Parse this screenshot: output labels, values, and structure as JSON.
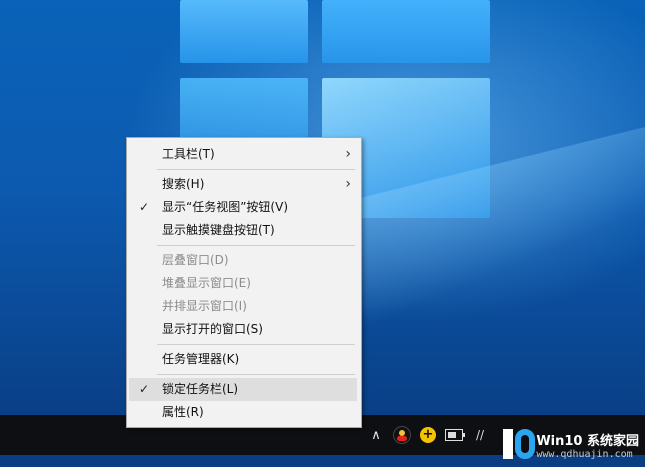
{
  "context_menu": {
    "items": [
      {
        "label": "工具栏(T)",
        "submenu": true,
        "checked": false,
        "disabled": false
      },
      {
        "label": "搜索(H)",
        "submenu": true,
        "checked": false,
        "disabled": false
      },
      {
        "label": "显示“任务视图”按钮(V)",
        "submenu": false,
        "checked": true,
        "disabled": false
      },
      {
        "label": "显示触摸键盘按钮(T)",
        "submenu": false,
        "checked": false,
        "disabled": false
      },
      {
        "label": "层叠窗口(D)",
        "submenu": false,
        "checked": false,
        "disabled": true
      },
      {
        "label": "堆叠显示窗口(E)",
        "submenu": false,
        "checked": false,
        "disabled": true
      },
      {
        "label": "并排显示窗口(I)",
        "submenu": false,
        "checked": false,
        "disabled": true
      },
      {
        "label": "显示打开的窗口(S)",
        "submenu": false,
        "checked": false,
        "disabled": false
      },
      {
        "label": "任务管理器(K)",
        "submenu": false,
        "checked": false,
        "disabled": false
      },
      {
        "label": "锁定任务栏(L)",
        "submenu": false,
        "checked": true,
        "disabled": false,
        "highlighted": true
      },
      {
        "label": "属性(R)",
        "submenu": false,
        "checked": false,
        "disabled": false
      }
    ],
    "check_glyph": "✓",
    "submenu_glyph": "›"
  },
  "taskbar": {
    "tray_icons": [
      "chevron-up-icon",
      "qq-icon",
      "add-icon",
      "battery-icon",
      "network-icon"
    ],
    "chevron_glyph": "∧",
    "network_glyph": "//"
  },
  "watermark": {
    "title": "Win10 系统家园",
    "url": "www.qdhuajin.com"
  },
  "colors": {
    "menu_bg": "#f2f2f2",
    "menu_highlight": "#dedede",
    "taskbar_bg": "#0e0f12",
    "desktop_blue": "#0a63b8"
  }
}
